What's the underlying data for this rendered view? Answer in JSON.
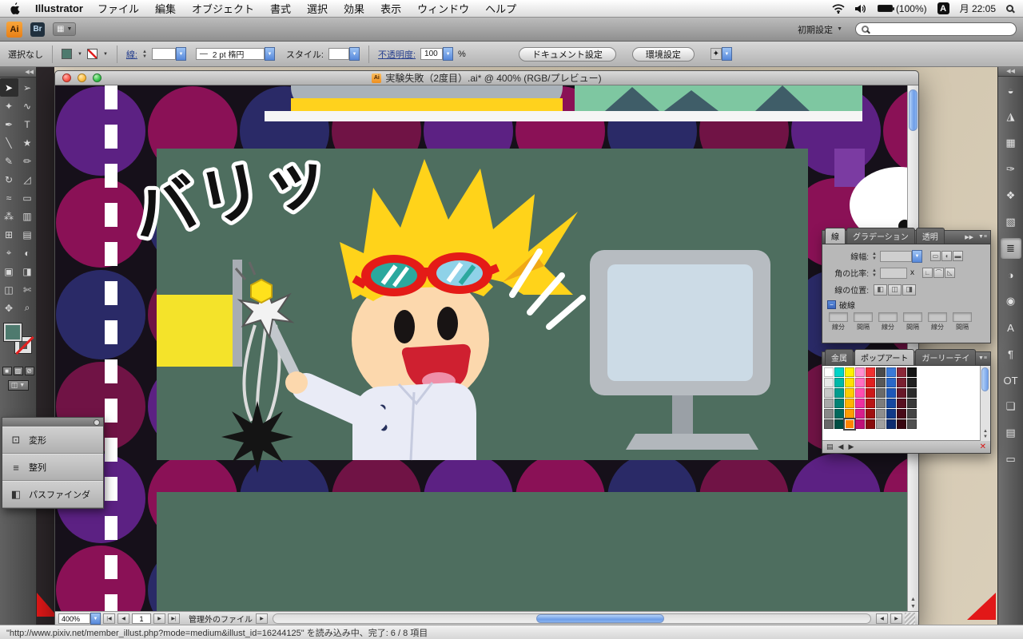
{
  "icons": {
    "dropdown": "▼",
    "up": "▲",
    "down": "▼",
    "left": "◀",
    "right": "▶",
    "first": "|◀",
    "last": "▶|",
    "collapse_left": "◀◀",
    "collapse_right": "▶▶",
    "panel_menu": "▼≡",
    "search": "⌕"
  },
  "menu_bar": {
    "app_name": "Illustrator",
    "menus": [
      "ファイル",
      "編集",
      "オブジェクト",
      "書式",
      "選択",
      "効果",
      "表示",
      "ウィンドウ",
      "ヘルプ"
    ],
    "battery": "(100%)",
    "input_source": "A",
    "clock": "月 22:05"
  },
  "app_bar": {
    "logo": "Ai",
    "bridge": "Br",
    "arrange_glyph": "▦",
    "workspace": "初期設定",
    "search_placeholder": ""
  },
  "control_bar": {
    "selection_status": "選択なし",
    "stroke_link": "線:",
    "brush_preview": "—",
    "brush_value": "2 pt 楕円",
    "style_label": "スタイル:",
    "opacity_link": "不透明度:",
    "opacity_value": "100",
    "percent": "%",
    "doc_setup_button": "ドキュメント設定",
    "preferences_button": "環境設定",
    "select_similar_glyph": "✦"
  },
  "appearance": {
    "fill_color": "#4e7a6e"
  },
  "toolbar": {
    "tools": [
      {
        "name": "selection-tool",
        "glyph": "➤",
        "active": true
      },
      {
        "name": "direct-selection-tool",
        "glyph": "➢"
      },
      {
        "name": "magic-wand-tool",
        "glyph": "✦"
      },
      {
        "name": "lasso-tool",
        "glyph": "∿"
      },
      {
        "name": "pen-tool",
        "glyph": "✒"
      },
      {
        "name": "type-tool",
        "glyph": "T"
      },
      {
        "name": "line-tool",
        "glyph": "╲"
      },
      {
        "name": "shape-tool",
        "glyph": "★"
      },
      {
        "name": "paintbrush-tool",
        "glyph": "✎"
      },
      {
        "name": "pencil-tool",
        "glyph": "✏"
      },
      {
        "name": "rotate-tool",
        "glyph": "↻"
      },
      {
        "name": "scale-tool",
        "glyph": "◿"
      },
      {
        "name": "warp-tool",
        "glyph": "≈"
      },
      {
        "name": "free-transform-tool",
        "glyph": "▭"
      },
      {
        "name": "symbol-sprayer-tool",
        "glyph": "⁂"
      },
      {
        "name": "graph-tool",
        "glyph": "▥"
      },
      {
        "name": "mesh-tool",
        "glyph": "⊞"
      },
      {
        "name": "gradient-tool",
        "glyph": "▤"
      },
      {
        "name": "eyedropper-tool",
        "glyph": "⌖"
      },
      {
        "name": "blend-tool",
        "glyph": "◐"
      },
      {
        "name": "live-paint-bucket-tool",
        "glyph": "▣"
      },
      {
        "name": "live-paint-selection-tool",
        "glyph": "◨"
      },
      {
        "name": "artboard-tool",
        "glyph": "◫"
      },
      {
        "name": "slice-tool",
        "glyph": "✄"
      },
      {
        "name": "hand-tool",
        "glyph": "✥"
      },
      {
        "name": "zoom-tool",
        "glyph": "⌕"
      }
    ],
    "bottom_buttons": [
      {
        "name": "color-mode-button",
        "glyph": "■"
      },
      {
        "name": "gradient-mode-button",
        "glyph": "▨"
      },
      {
        "name": "none-mode-button",
        "glyph": "⊘"
      },
      {
        "name": "screen-mode-button",
        "glyph": "◫"
      }
    ]
  },
  "left_panel_stack": {
    "items": [
      {
        "name": "transform",
        "label": "変形",
        "glyph": "⊡"
      },
      {
        "name": "align",
        "label": "整列",
        "glyph": "≡"
      },
      {
        "name": "pathfinder",
        "label": "パスファインダ",
        "glyph": "◧"
      }
    ]
  },
  "document_window": {
    "title": "実験失敗（2度目）.ai* @ 400% (RGB/プレビュー)",
    "doc_icon": "Ai",
    "zoom": "400%",
    "page": "1",
    "status": "管理外のファイル"
  },
  "artwork": {
    "sfx_text": "バリッ",
    "dot_colors": [
      "#5c2183",
      "#8a1156",
      "#2a2a67",
      "#701345"
    ],
    "board_color": "#4e6e5f",
    "hair_color": "#ffd31a",
    "goggle_color": "#e41b17"
  },
  "stroke_panel": {
    "tabs": [
      "線",
      "グラデーション",
      "透明"
    ],
    "weight_label": "線幅:",
    "miter_label": "角の比率:",
    "x_label": "x",
    "align_label": "線の位置:",
    "dashed_label": "破線",
    "dashed_check": "−",
    "dash_gap_labels": [
      "線分",
      "間隔",
      "線分",
      "間隔",
      "線分",
      "間隔"
    ],
    "cap_icons": [
      "▭",
      "◖",
      "▬"
    ],
    "join_icons": [
      "∟",
      "⌒",
      "◺"
    ],
    "align_icons": [
      "◧",
      "◫",
      "◨"
    ]
  },
  "swatches_panel": {
    "tabs": [
      "金属",
      "ポップアート",
      "ガーリーテイ"
    ],
    "active_tab": "ポップアート",
    "selected_index": 47,
    "colors": [
      "#ffffff",
      "#00d4c8",
      "#fff200",
      "#ff8fd0",
      "#f23030",
      "#4a4a4a",
      "#3a7ad8",
      "#8c2838",
      "#141414",
      "#e8e8e8",
      "#00b8a8",
      "#ffe000",
      "#ff6ec0",
      "#e02020",
      "#585858",
      "#2a68c8",
      "#7a2030",
      "#202020",
      "#c8c8c8",
      "#009c8e",
      "#ffcc00",
      "#ff4cb0",
      "#cc1818",
      "#6a6a6a",
      "#1e58b8",
      "#681828",
      "#2c2c2c",
      "#a8a8a8",
      "#008274",
      "#ffb400",
      "#ee2fa0",
      "#b81414",
      "#7c7c7c",
      "#1648a0",
      "#581020",
      "#383838",
      "#888888",
      "#00685c",
      "#ff9c00",
      "#d81e8c",
      "#a01010",
      "#8e8e8e",
      "#103a88",
      "#480a18",
      "#444444",
      "#686868",
      "#004e44",
      "#ff8400",
      "#c01078",
      "#880c0c",
      "#a0a0a0",
      "#0c2c70",
      "#380610",
      "#505050"
    ],
    "footer": {
      "library_glyph": "▤",
      "prev": "◀",
      "next": "▶",
      "none_glyph": "✕"
    }
  },
  "dock": {
    "icons": [
      {
        "name": "color",
        "glyph": "◒"
      },
      {
        "name": "color-guide",
        "glyph": "◮"
      },
      {
        "name": "swatches",
        "glyph": "▦"
      },
      {
        "name": "brushes",
        "glyph": "✑"
      },
      {
        "name": "symbols",
        "glyph": "❖"
      },
      {
        "name": "gradient",
        "glyph": "▧"
      },
      {
        "name": "stroke",
        "glyph": "≣",
        "active": true
      },
      {
        "name": "transparency",
        "glyph": "◑"
      },
      {
        "name": "appearance",
        "glyph": "◉"
      },
      {
        "name": "character",
        "glyph": "A"
      },
      {
        "name": "paragraph",
        "glyph": "¶"
      },
      {
        "name": "opentype",
        "glyph": "OT"
      },
      {
        "name": "graphic-styles",
        "glyph": "❏"
      },
      {
        "name": "layers",
        "glyph": "▤"
      },
      {
        "name": "artboards",
        "glyph": "▭"
      }
    ]
  },
  "status_bar": {
    "text": "\"http://www.pixiv.net/member_illust.php?mode=medium&illust_id=16244125\" を読み込み中、完了: 6 / 8 項目"
  }
}
